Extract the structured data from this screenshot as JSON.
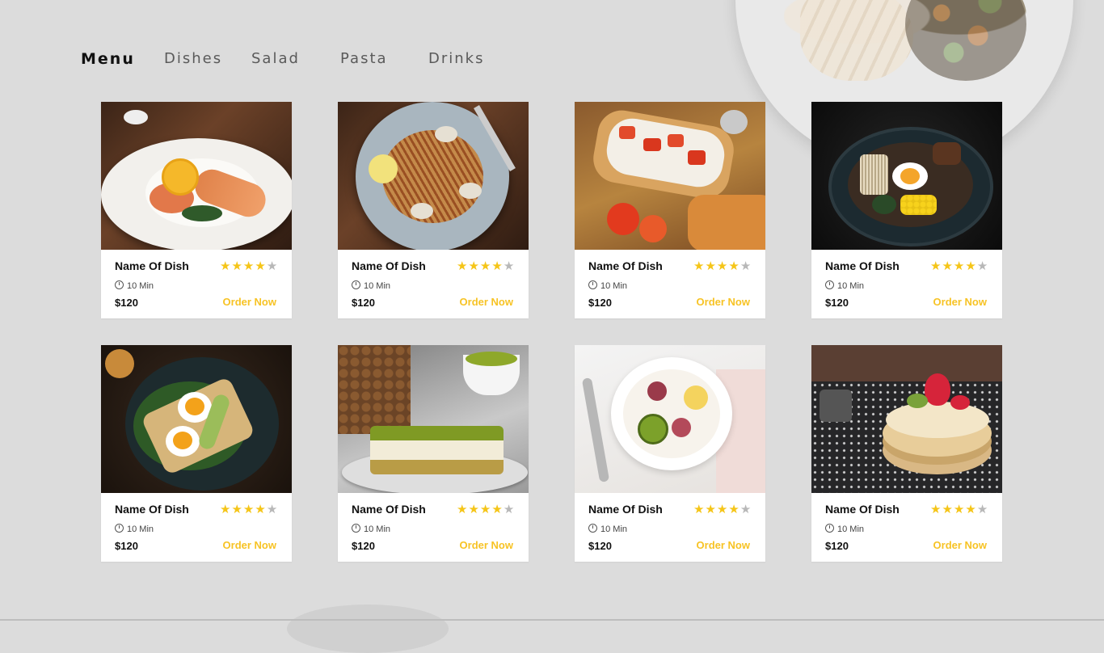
{
  "nav": {
    "items": [
      {
        "label": "Menu",
        "active": true
      },
      {
        "label": "Dishes",
        "active": false
      },
      {
        "label": "Salad",
        "active": false
      },
      {
        "label": "Pasta",
        "active": false
      },
      {
        "label": "Drinks",
        "active": false
      }
    ]
  },
  "colors": {
    "accent": "#f7c325",
    "star_on": "#f5c518",
    "star_off": "#b8b8b8",
    "background": "#dcdcdc"
  },
  "cards": [
    {
      "photo": "grilled-salmon-shrimp",
      "name": "Name Of Dish",
      "rating": 4,
      "max_rating": 5,
      "time": "10 Min",
      "price": "$120",
      "action": "Order Now"
    },
    {
      "photo": "clam-spaghetti",
      "name": "Name Of Dish",
      "rating": 4,
      "max_rating": 5,
      "time": "10 Min",
      "price": "$120",
      "action": "Order Now"
    },
    {
      "photo": "tomato-bruschetta",
      "name": "Name Of Dish",
      "rating": 4,
      "max_rating": 5,
      "time": "10 Min",
      "price": "$120",
      "action": "Order Now"
    },
    {
      "photo": "ramen-bowl",
      "name": "Name Of Dish",
      "rating": 4,
      "max_rating": 5,
      "time": "10 Min",
      "price": "$120",
      "action": "Order Now"
    },
    {
      "photo": "egg-avocado-toast",
      "name": "Name Of Dish",
      "rating": 4,
      "max_rating": 5,
      "time": "10 Min",
      "price": "$120",
      "action": "Order Now"
    },
    {
      "photo": "pistachio-cake",
      "name": "Name Of Dish",
      "rating": 4,
      "max_rating": 5,
      "time": "10 Min",
      "price": "$120",
      "action": "Order Now"
    },
    {
      "photo": "fruit-yogurt-bowl",
      "name": "Name Of Dish",
      "rating": 4,
      "max_rating": 5,
      "time": "10 Min",
      "price": "$120",
      "action": "Order Now"
    },
    {
      "photo": "strawberry-pancakes",
      "name": "Name Of Dish",
      "rating": 4,
      "max_rating": 5,
      "time": "10 Min",
      "price": "$120",
      "action": "Order Now"
    }
  ]
}
